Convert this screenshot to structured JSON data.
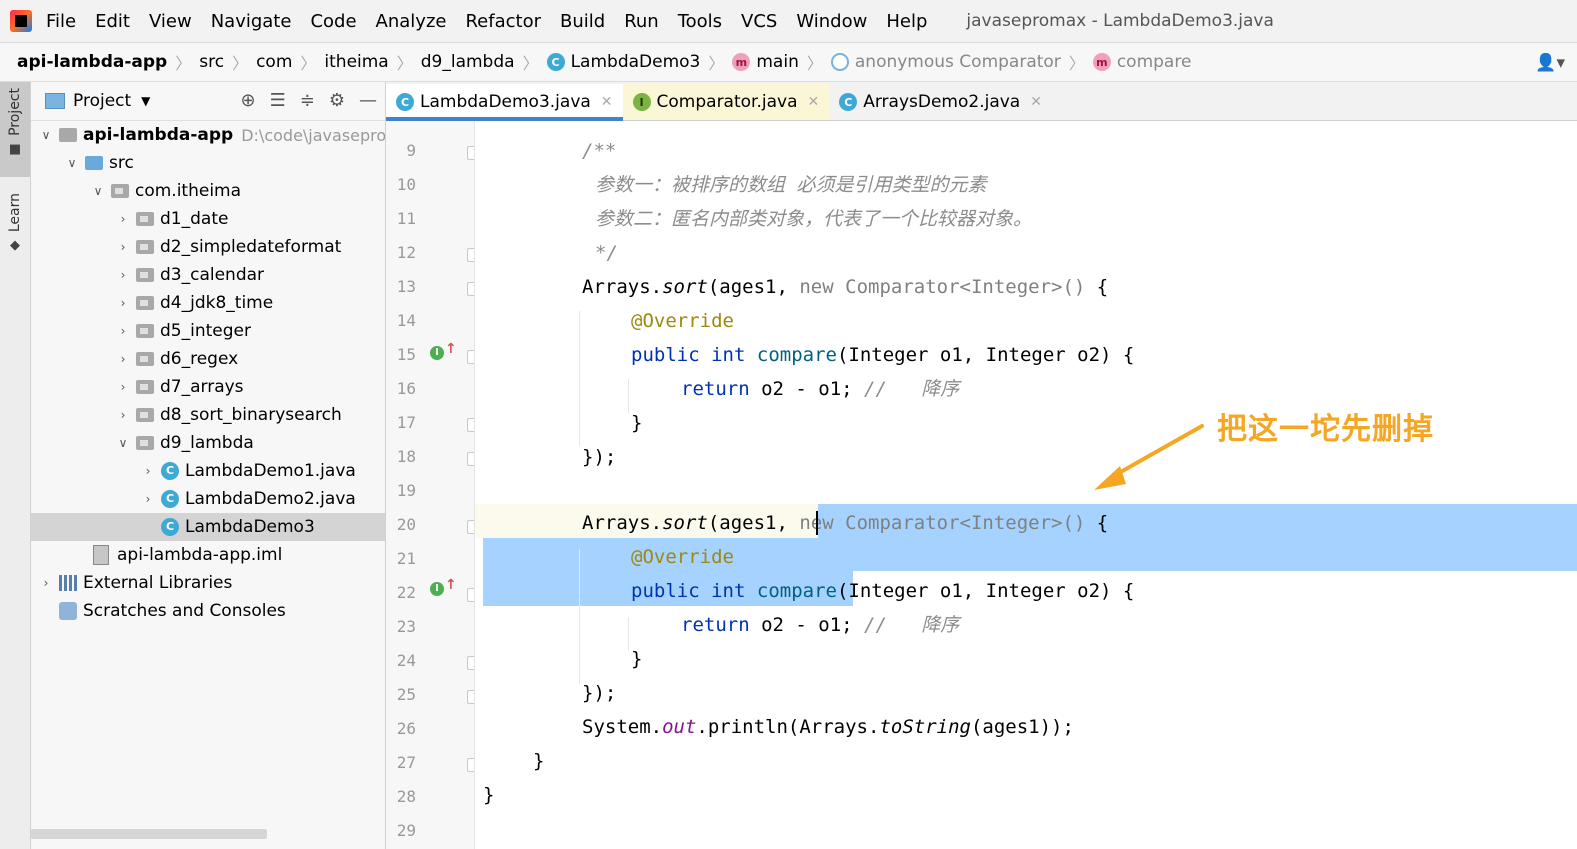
{
  "menubar": {
    "items": [
      "File",
      "Edit",
      "View",
      "Navigate",
      "Code",
      "Analyze",
      "Refactor",
      "Build",
      "Run",
      "Tools",
      "VCS",
      "Window",
      "Help"
    ],
    "window_title": "javasepromax - LambdaDemo3.java"
  },
  "breadcrumb": {
    "items": [
      "api-lambda-app",
      "src",
      "com",
      "itheima",
      "d9_lambda",
      "LambdaDemo3",
      "main",
      "anonymous Comparator",
      "compare"
    ]
  },
  "side_tabs": {
    "project": "Project",
    "learn": "Learn"
  },
  "project_panel": {
    "title": "Project",
    "root": "api-lambda-app",
    "root_path": "D:\\code\\javasepro",
    "src": "src",
    "package": "com.itheima",
    "folders": [
      "d1_date",
      "d2_simpledateformat",
      "d3_calendar",
      "d4_jdk8_time",
      "d5_integer",
      "d6_regex",
      "d7_arrays",
      "d8_sort_binarysearch",
      "d9_lambda"
    ],
    "files": [
      "LambdaDemo1.java",
      "LambdaDemo2.java",
      "LambdaDemo3"
    ],
    "iml": "api-lambda-app.iml",
    "external": "External Libraries",
    "scratches": "Scratches and Consoles"
  },
  "tabs": [
    {
      "label": "LambdaDemo3.java",
      "icon": "C"
    },
    {
      "label": "Comparator.java",
      "icon": "I"
    },
    {
      "label": "ArraysDemo2.java",
      "icon": "C"
    }
  ],
  "gutter": {
    "line_numbers": [
      "9",
      "10",
      "11",
      "12",
      "13",
      "14",
      "15",
      "16",
      "17",
      "18",
      "19",
      "20",
      "21",
      "22",
      "23",
      "24",
      "25",
      "26",
      "27",
      "28",
      "29"
    ]
  },
  "code": {
    "l9": "/**",
    "l10": "参数一：被排序的数组 必须是引用类型的元素",
    "l11": "参数二：匿名内部类对象，代表了一个比较器对象。",
    "l12": "*/",
    "sort_call": "Arrays.",
    "sort_fn": "sort",
    "sort_args": "(ages1, ",
    "new_kw": "new",
    "comparator_type": " Comparator<Integer>()",
    "brace_open": " {",
    "override": "@Override",
    "public_kw": "public",
    "int_kw": "int",
    "compare_fn": "compare",
    "compare_params": "(Integer o1, Integer o2) {",
    "return_kw": "return",
    "return_expr": " o2 - o1; ",
    "comment_desc": "//   降序",
    "close_brace": "}",
    "close_call": "});",
    "println_prefix": "System.",
    "println_out": "out",
    "println_mid": ".println(Arrays.",
    "println_tostring": "toString",
    "println_end": "(ages1));"
  },
  "annotation": {
    "text": "把这一坨先删掉",
    "color": "#f5a623"
  },
  "colors": {
    "selection": "#a6d2ff",
    "keyword": "#0033b3",
    "annotation_marker": "#9e880d",
    "method": "#00627a"
  }
}
